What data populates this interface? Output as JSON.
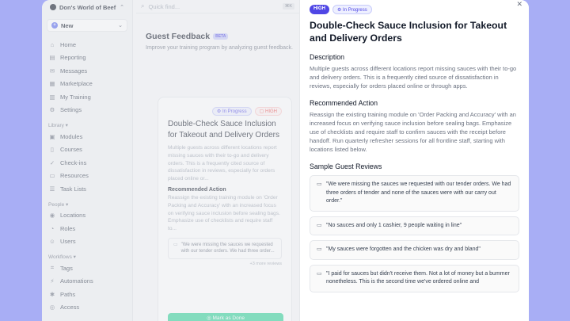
{
  "sidebar": {
    "org_name": "Don's World of Beef",
    "new_label": "New",
    "main_items": [
      {
        "label": "Home",
        "icon": "home-icon",
        "glyph": "⌂"
      },
      {
        "label": "Reporting",
        "icon": "chart-icon",
        "glyph": "▤"
      },
      {
        "label": "Messages",
        "icon": "message-icon",
        "glyph": "✉"
      },
      {
        "label": "Marketplace",
        "icon": "store-icon",
        "glyph": "▦"
      },
      {
        "label": "My Training",
        "icon": "book-icon",
        "glyph": "▥"
      },
      {
        "label": "Settings",
        "icon": "gear-icon",
        "glyph": "⚙"
      }
    ],
    "library_title": "Library ▾",
    "library_items": [
      {
        "label": "Modules",
        "icon": "module-icon",
        "glyph": "▣"
      },
      {
        "label": "Courses",
        "icon": "bookmark-icon",
        "glyph": "▯"
      },
      {
        "label": "Check-ins",
        "icon": "checkin-icon",
        "glyph": "✓"
      },
      {
        "label": "Resources",
        "icon": "folder-icon",
        "glyph": "▭"
      },
      {
        "label": "Task Lists",
        "icon": "list-icon",
        "glyph": "☰"
      }
    ],
    "people_title": "People ▾",
    "people_items": [
      {
        "label": "Locations",
        "icon": "location-icon",
        "glyph": "◉"
      },
      {
        "label": "Roles",
        "icon": "role-icon",
        "glyph": "◔"
      },
      {
        "label": "Users",
        "icon": "users-icon",
        "glyph": "☺"
      }
    ],
    "workflows_title": "Workflows ▾",
    "workflow_items": [
      {
        "label": "Tags",
        "icon": "tag-icon",
        "glyph": "⌗"
      },
      {
        "label": "Automations",
        "icon": "automation-icon",
        "glyph": "⚡"
      },
      {
        "label": "Paths",
        "icon": "paths-icon",
        "glyph": "✱"
      },
      {
        "label": "Access",
        "icon": "access-icon",
        "glyph": "◎"
      }
    ]
  },
  "search": {
    "placeholder": "Quick find...",
    "shortcut": "⌘K"
  },
  "page": {
    "title": "Guest Feedback",
    "badge": "BETA",
    "subtitle": "Improve your training program by analyzing guest feedback."
  },
  "card": {
    "status": "In Progress",
    "priority": "HIGH",
    "title": "Double-Check Sauce Inclusion for Takeout and Delivery Orders",
    "description": "Multiple guests across different locations report missing sauces with their to-go and delivery orders. This is a frequently cited source of dissatisfaction in reviews, especially for orders placed online or...",
    "action_heading": "Recommended Action",
    "action": "Reassign the existing training module on 'Order Packing and Accuracy' with an increased focus on verifying sauce inclusion before sealing bags. Emphasize use of checklists and require staff to...",
    "quote": "\"We were missing the sauces we requested with our tender orders. We had three order...",
    "more": "+3 more reviews",
    "done_label": "Mark as Done"
  },
  "panel": {
    "priority": "HIGH",
    "status": "In Progress",
    "title": "Double-Check Sauce Inclusion for Takeout and Delivery Orders",
    "description_heading": "Description",
    "description": "Multiple guests across different locations report missing sauces with their to-go and delivery orders. This is a frequently cited source of dissatisfaction in reviews, especially for orders placed online or through apps.",
    "action_heading": "Recommended Action",
    "action": "Reassign the existing training module on 'Order Packing and Accuracy' with an increased focus on verifying sauce inclusion before sealing bags. Emphasize use of checklists and require staff to confirm sauces with the receipt before handoff. Run quarterly refresher sessions for all frontline staff, starting with locations listed below.",
    "reviews_heading": "Sample Guest Reviews",
    "reviews": [
      "\"We were missing the sauces we requested with our tender orders. We had three orders of tender and none of the sauces were with our carry out order.\"",
      "\"No sauces and only 1 cashier, 9 people waiting in line\"",
      "\"My sauces were forgotten and the chicken was dry and bland\"",
      "\"I paid for sauces but didn't receive them. Not a lot of money but a bummer nonetheless. This is the second time we've ordered online and"
    ]
  }
}
